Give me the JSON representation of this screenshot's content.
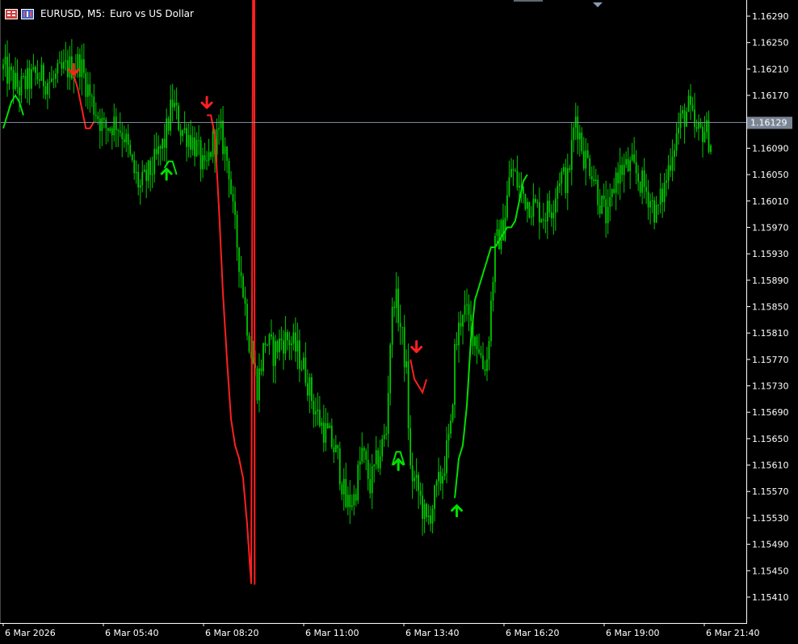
{
  "window": {
    "symbol": "EURUSD, M5:",
    "description": "Euro vs US Dollar",
    "header_icons": [
      "one-click-trading-icon",
      "market-depth-icon"
    ]
  },
  "colors": {
    "background": "#000000",
    "axis": "#ffffff",
    "candle": "#00c800",
    "bid_line": "#7f8c9a",
    "ma_down": "#ff2020",
    "ma_up": "#00e000",
    "arrow_down": "#ff2020",
    "arrow_up": "#00e000",
    "price_label_bg": "#7a8594"
  },
  "price_tag": "1.16129",
  "chart_data": {
    "type": "candlestick",
    "title": "",
    "xlabel": "",
    "ylabel": "",
    "ylim": [
      1.1538,
      1.1632
    ],
    "grid": false,
    "y_ticks": [
      "1.16290",
      "1.16250",
      "1.16210",
      "1.16170",
      "1.16129",
      "1.16090",
      "1.16050",
      "1.16010",
      "1.15970",
      "1.15930",
      "1.15890",
      "1.15850",
      "1.15810",
      "1.15770",
      "1.15730",
      "1.15690",
      "1.15650",
      "1.15610",
      "1.15570",
      "1.15530",
      "1.15490",
      "1.15450",
      "1.15410"
    ],
    "x_ticks": [
      "6 Mar 2026",
      "6 Mar 05:40",
      "6 Mar 08:20",
      "6 Mar 11:00",
      "6 Mar 13:40",
      "6 Mar 16:20",
      "6 Mar 19:00",
      "6 Mar 21:40"
    ],
    "current_price": 1.16129,
    "candle_anchors": [
      [
        0,
        1.1621
      ],
      [
        8,
        1.1618
      ],
      [
        16,
        1.162
      ],
      [
        24,
        1.1619
      ],
      [
        31,
        1.1621
      ],
      [
        38,
        1.1622
      ],
      [
        44,
        1.1616
      ],
      [
        50,
        1.1612
      ],
      [
        56,
        1.1613
      ],
      [
        60,
        1.1611
      ],
      [
        64,
        1.1606
      ],
      [
        68,
        1.1603
      ],
      [
        74,
        1.1606
      ],
      [
        80,
        1.161
      ],
      [
        84,
        1.1616
      ],
      [
        88,
        1.1612
      ],
      [
        92,
        1.1611
      ],
      [
        96,
        1.1609
      ],
      [
        100,
        1.1605
      ],
      [
        104,
        1.161
      ],
      [
        108,
        1.1611
      ],
      [
        112,
        1.1606
      ],
      [
        114,
        1.1599
      ],
      [
        118,
        1.159
      ],
      [
        122,
        1.158
      ],
      [
        126,
        1.1573
      ],
      [
        130,
        1.158
      ],
      [
        134,
        1.1578
      ],
      [
        138,
        1.158
      ],
      [
        142,
        1.158
      ],
      [
        146,
        1.1578
      ],
      [
        150,
        1.1575
      ],
      [
        154,
        1.157
      ],
      [
        158,
        1.1567
      ],
      [
        162,
        1.1565
      ],
      [
        166,
        1.1562
      ],
      [
        170,
        1.1555
      ],
      [
        174,
        1.1556
      ],
      [
        178,
        1.1563
      ],
      [
        182,
        1.1558
      ],
      [
        186,
        1.1562
      ],
      [
        190,
        1.1566
      ],
      [
        192,
        1.158
      ],
      [
        194,
        1.1587
      ],
      [
        196,
        1.1584
      ],
      [
        198,
        1.158
      ],
      [
        200,
        1.1575
      ],
      [
        202,
        1.156
      ],
      [
        206,
        1.1557
      ],
      [
        210,
        1.1552
      ],
      [
        214,
        1.1556
      ],
      [
        218,
        1.156
      ],
      [
        222,
        1.1566
      ],
      [
        224,
        1.1578
      ],
      [
        228,
        1.1585
      ],
      [
        232,
        1.1582
      ],
      [
        236,
        1.1579
      ],
      [
        238,
        1.1576
      ],
      [
        240,
        1.1577
      ],
      [
        244,
        1.1594
      ],
      [
        248,
        1.1597
      ],
      [
        252,
        1.1606
      ],
      [
        256,
        1.1603
      ],
      [
        260,
        1.1601
      ],
      [
        264,
        1.16
      ],
      [
        268,
        1.1599
      ],
      [
        272,
        1.16
      ],
      [
        276,
        1.1605
      ],
      [
        280,
        1.1604
      ],
      [
        284,
        1.1614
      ],
      [
        288,
        1.1608
      ],
      [
        292,
        1.1606
      ],
      [
        296,
        1.1601
      ],
      [
        300,
        1.1598
      ],
      [
        304,
        1.1605
      ],
      [
        308,
        1.1606
      ],
      [
        312,
        1.1606
      ],
      [
        316,
        1.1604
      ],
      [
        320,
        1.1602
      ],
      [
        324,
        1.1599
      ],
      [
        328,
        1.1603
      ],
      [
        332,
        1.1609
      ],
      [
        336,
        1.1613
      ],
      [
        340,
        1.1615
      ],
      [
        344,
        1.1611
      ],
      [
        348,
        1.1612
      ],
      [
        351,
        1.161
      ]
    ],
    "n_bars": 352,
    "moving_average": {
      "down_segments": [
        {
          "from_bar": 35,
          "points": [
            1.162,
            1.1618,
            1.1615,
            1.1612,
            1.1612,
            1.1613
          ]
        },
        {
          "from_bar": 101,
          "points": [
            1.1614,
            1.1614,
            1.1611,
            1.16,
            1.1587,
            1.1577,
            1.1568,
            1.1564,
            1.1562,
            1.1559,
            1.1552,
            1.1543,
            1.174
          ]
        },
        {
          "from_bar": 202,
          "points": [
            1.1577,
            1.1574,
            1.1573,
            1.1572,
            1.1574
          ]
        }
      ],
      "up_segments": [
        {
          "from_bar": 0,
          "points": [
            1.1612,
            1.1614,
            1.1616,
            1.1617,
            1.1616,
            1.1614
          ]
        },
        {
          "from_bar": 80,
          "points": [
            1.1606,
            1.1607,
            1.1607,
            1.1605
          ]
        },
        {
          "from_bar": 193,
          "points": [
            1.1561,
            1.1563,
            1.1563,
            1.1561
          ]
        },
        {
          "from_bar": 224,
          "points": [
            1.1556,
            1.1562,
            1.1564,
            1.157,
            1.158,
            1.1586,
            1.1588,
            1.159,
            1.1592,
            1.1594,
            1.1594,
            1.1595,
            1.1596,
            1.1597,
            1.1597,
            1.1598,
            1.1601,
            1.1604,
            1.1605
          ]
        }
      ]
    },
    "signals": [
      {
        "bar": 35,
        "direction": "down",
        "price": 1.1621
      },
      {
        "bar": 81,
        "direction": "up",
        "price": 1.1605
      },
      {
        "bar": 101,
        "direction": "down",
        "price": 1.1616
      },
      {
        "bar": 196,
        "direction": "up",
        "price": 1.1561
      },
      {
        "bar": 205,
        "direction": "down",
        "price": 1.1579
      },
      {
        "bar": 225,
        "direction": "up",
        "price": 1.1554
      }
    ]
  }
}
